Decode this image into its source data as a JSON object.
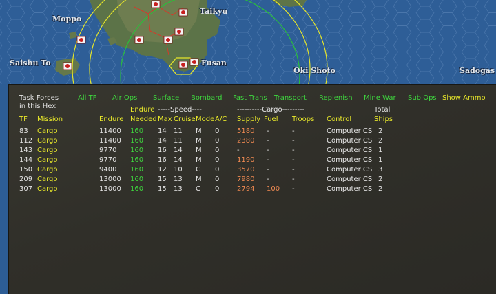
{
  "map": {
    "labels": [
      "Moppo",
      "Taikyu",
      "Saishu To",
      "Fusan",
      "Oki Shoto",
      "Sadogas"
    ]
  },
  "panel": {
    "title_line1": "Task Forces",
    "title_line2": "in this Hex",
    "filters": [
      "All TF",
      "Air Ops",
      "Surface",
      "Bombard",
      "Fast Trans",
      "Transport",
      "Replenish",
      "Mine War",
      "Sub Ops"
    ],
    "show_ammo": "Show Ammo",
    "group_headers": {
      "endure": "Endure",
      "speed": "-----Speed----",
      "cargo": "----------Cargo---------",
      "total": "Total"
    },
    "columns": {
      "tf": "TF",
      "mission": "Mission",
      "endure": "Endure",
      "needed": "Needed",
      "max": "Max",
      "cruise": "Cruise",
      "mode": "Mode",
      "ac": "A/C",
      "supply": "Supply",
      "fuel": "Fuel",
      "troops": "Troops",
      "control": "Control",
      "ships": "Ships"
    },
    "rows": [
      {
        "tf": "83",
        "mission": "Cargo",
        "endure": "11400",
        "needed": "160",
        "max": "14",
        "cruise": "11",
        "mode": "M",
        "ac": "0",
        "supply": "5180",
        "fuel": "-",
        "troops": "-",
        "control": "Computer CS",
        "ships": "2"
      },
      {
        "tf": "112",
        "mission": "Cargo",
        "endure": "11400",
        "needed": "160",
        "max": "14",
        "cruise": "11",
        "mode": "M",
        "ac": "0",
        "supply": "2380",
        "fuel": "-",
        "troops": "-",
        "control": "Computer CS",
        "ships": "2"
      },
      {
        "tf": "143",
        "mission": "Cargo",
        "endure": "9770",
        "needed": "160",
        "max": "16",
        "cruise": "14",
        "mode": "M",
        "ac": "0",
        "supply": "-",
        "fuel": "-",
        "troops": "-",
        "control": "Computer CS",
        "ships": "1"
      },
      {
        "tf": "144",
        "mission": "Cargo",
        "endure": "9770",
        "needed": "160",
        "max": "16",
        "cruise": "14",
        "mode": "M",
        "ac": "0",
        "supply": "1190",
        "fuel": "-",
        "troops": "-",
        "control": "Computer CS",
        "ships": "1"
      },
      {
        "tf": "150",
        "mission": "Cargo",
        "endure": "9400",
        "needed": "160",
        "max": "12",
        "cruise": "10",
        "mode": "C",
        "ac": "0",
        "supply": "3570",
        "fuel": "-",
        "troops": "-",
        "control": "Computer CS",
        "ships": "3"
      },
      {
        "tf": "209",
        "mission": "Cargo",
        "endure": "13000",
        "needed": "160",
        "max": "15",
        "cruise": "13",
        "mode": "M",
        "ac": "0",
        "supply": "7980",
        "fuel": "-",
        "troops": "-",
        "control": "Computer CS",
        "ships": "2"
      },
      {
        "tf": "307",
        "mission": "Cargo",
        "endure": "13000",
        "needed": "160",
        "max": "15",
        "cruise": "13",
        "mode": "C",
        "ac": "0",
        "supply": "2794",
        "fuel": "100",
        "troops": "-",
        "control": "Computer CS",
        "ships": "2"
      }
    ]
  },
  "colors": {
    "link_green": "#3ed63e",
    "mission_yellow": "#e8e82a",
    "supply_orange": "#f08a52",
    "panel_bg": "#33322c",
    "sea": "#2d5d95"
  }
}
